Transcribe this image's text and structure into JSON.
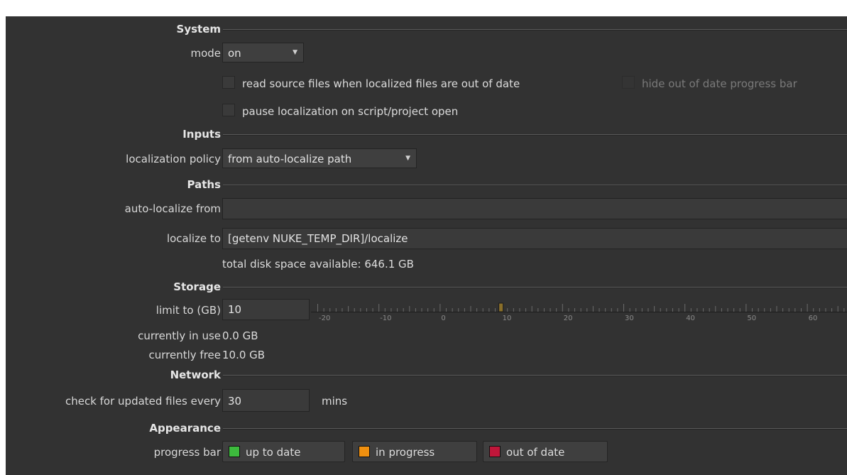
{
  "sections": {
    "system": "System",
    "inputs": "Inputs",
    "paths": "Paths",
    "storage": "Storage",
    "network": "Network",
    "appearance": "Appearance"
  },
  "system": {
    "mode_label": "mode",
    "mode_value": "on",
    "read_source_label": "read source files when localized files are out of date",
    "hide_progress_label": "hide out of date progress bar",
    "pause_label": "pause localization on script/project open"
  },
  "inputs": {
    "policy_label": "localization policy",
    "policy_value": "from auto-localize path"
  },
  "paths": {
    "auto_from_label": "auto-localize from",
    "auto_from_value": "",
    "localize_to_label": "localize to",
    "localize_to_value": "[getenv NUKE_TEMP_DIR]/localize",
    "disk_space": "total disk space available: 646.1 GB"
  },
  "storage": {
    "limit_label": "limit to (GB)",
    "limit_value": "10",
    "in_use_label": "currently in use",
    "in_use_value": "0.0 GB",
    "free_label": "currently free",
    "free_value": "10.0 GB",
    "slider_value": 10,
    "slider_range": [
      -20,
      60
    ],
    "slider_ticks": [
      "-20",
      "-10",
      "0",
      "10",
      "20",
      "30",
      "40",
      "50",
      "60"
    ]
  },
  "network": {
    "check_label": "check for updated files every",
    "check_value": "30",
    "unit": "mins"
  },
  "appearance": {
    "progress_label": "progress bar",
    "up_to_date": "up to date",
    "in_progress": "in progress",
    "out_of_date": "out of date",
    "colors": {
      "up_to_date": "#3dbb3d",
      "in_progress": "#f0900f",
      "out_of_date": "#c0163a"
    }
  }
}
